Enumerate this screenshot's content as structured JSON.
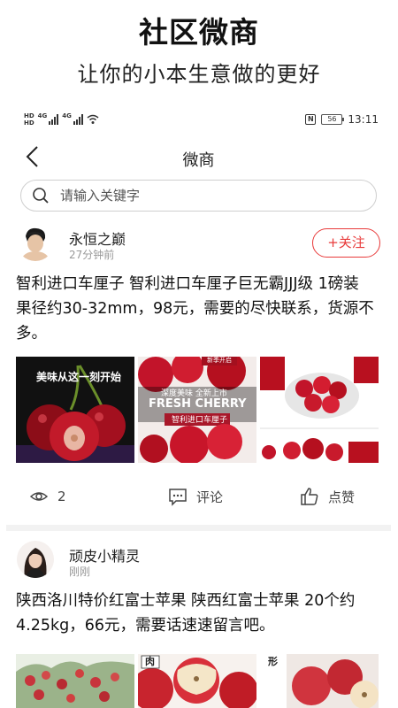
{
  "hero": {
    "title": "社区微商",
    "subtitle": "让你的小本生意做的更好"
  },
  "status_bar": {
    "network_a": "4G",
    "network_b": "4G",
    "battery": "56",
    "nfc": "N",
    "time": "13:11"
  },
  "navbar": {
    "title": "微商",
    "back_icon": "chevron-left-icon"
  },
  "search": {
    "placeholder": "请输入关键字",
    "icon": "search-icon"
  },
  "posts": [
    {
      "user": "永恒之巅",
      "time": "27分钟前",
      "follow_label": "+关注",
      "text": "智利进口车厘子 智利进口车厘子巨无霸JJJ级 1磅装 果径约30-32mm，98元，需要的尽快联系，货源不多。",
      "images": [
        {
          "caption": "美味从这一刻开始"
        },
        {
          "caption_top": "深度美味 全新上市",
          "caption_main": "FRESH CHERRY",
          "caption_bottom": "智利进口车厘子",
          "badge": "新季开启"
        },
        {
          "caption": ""
        }
      ],
      "views": "2",
      "comment_label": "评论",
      "like_label": "点赞"
    },
    {
      "user": "顽皮小精灵",
      "time": "刚刚",
      "text": "陕西洛川特价红富士苹果 陕西红富士苹果 20个约4.25kg，66元，需要话速速留言吧。",
      "images": [
        {
          "caption": ""
        },
        {
          "caption": "肉"
        },
        {
          "caption": "形"
        }
      ]
    }
  ],
  "colors": {
    "accent": "#e83a3a",
    "page_bg": "#f2f2f2",
    "muted_text": "#999999"
  }
}
